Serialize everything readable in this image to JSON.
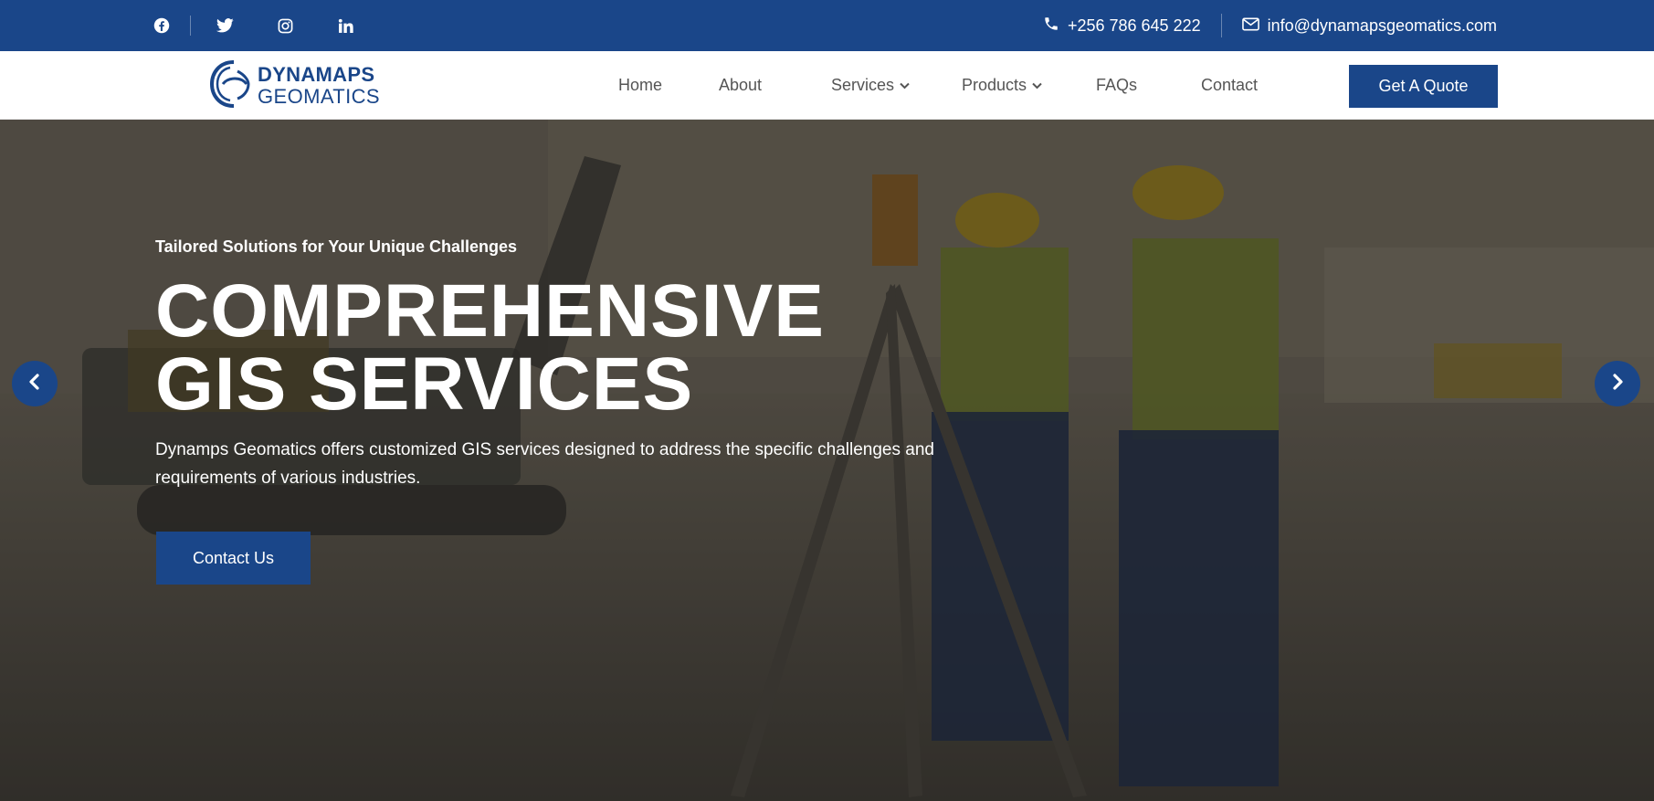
{
  "topbar": {
    "social": [
      {
        "name": "facebook-icon"
      },
      {
        "name": "twitter-icon"
      },
      {
        "name": "instagram-icon"
      },
      {
        "name": "linkedin-icon"
      }
    ],
    "phone": "+256 786 645 222",
    "email": "info@dynamapsgeomatics.com"
  },
  "logo": {
    "line1": "DYNAMAPS",
    "line2": "GEOMATICS"
  },
  "nav": {
    "items": [
      {
        "label": "Home"
      },
      {
        "label": "About"
      },
      {
        "label": "Services"
      },
      {
        "label": "Products"
      },
      {
        "label": "FAQs"
      },
      {
        "label": "Contact"
      }
    ],
    "quote_label": "Get A Quote"
  },
  "hero": {
    "eyebrow": "Tailored Solutions for Your Unique Challenges",
    "headline_line1": "COMPREHENSIVE",
    "headline_line2": "GIS SERVICES",
    "description": "Dynamps Geomatics offers customized GIS services designed to address the specific challenges and requirements of various industries.",
    "cta_label": "Contact Us"
  },
  "colors": {
    "brand": "#1a4689",
    "nav_text": "#555555",
    "hero_text": "#ffffff"
  }
}
